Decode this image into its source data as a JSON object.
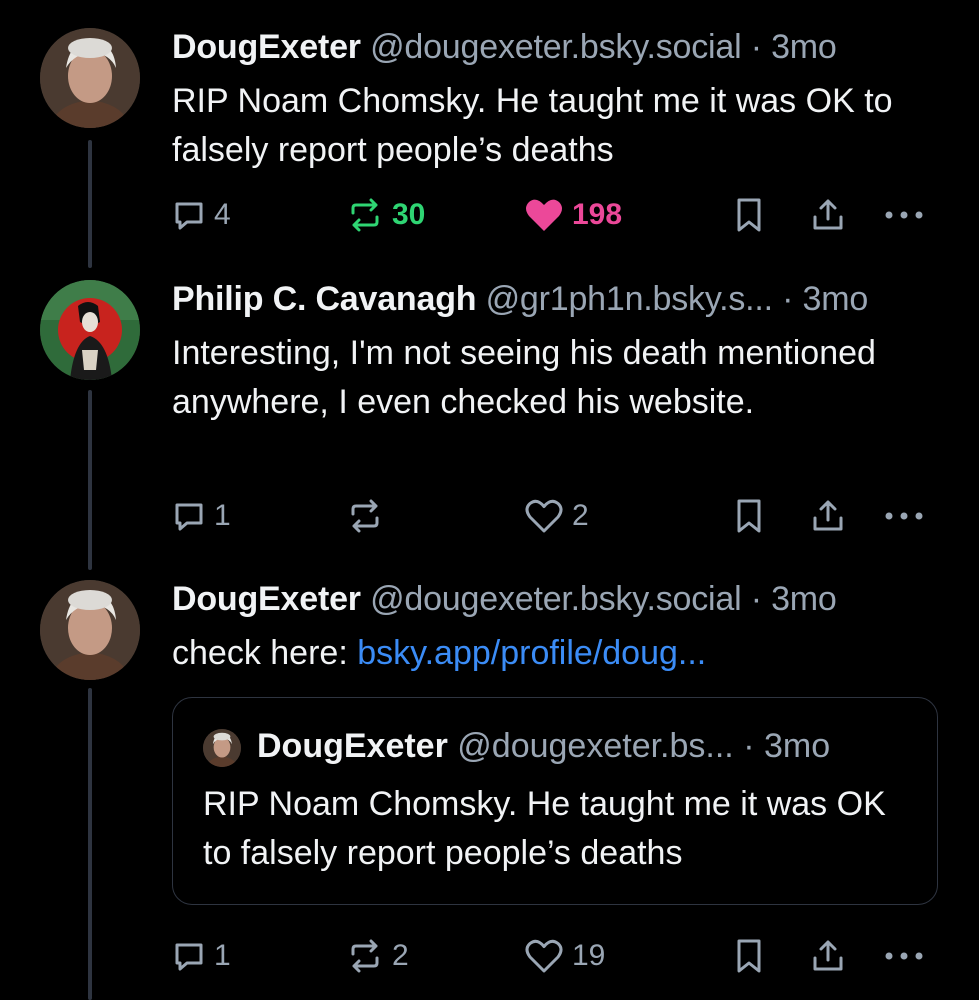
{
  "posts": [
    {
      "author_name": "DougExeter",
      "handle": "@dougexeter.bsky.social",
      "separator": "·",
      "time": "3mo",
      "text": "RIP Noam Chomsky. He taught me it was OK to falsely report people’s deaths",
      "replies": "4",
      "reposts": "30",
      "likes": "198",
      "reposted": true,
      "liked": true
    },
    {
      "author_name": "Philip C. Cavanagh",
      "handle": "@gr1ph1n.bsky.s...",
      "separator": "·",
      "time": "3mo",
      "text": "Interesting, I'm not seeing his death mentioned anywhere, I even checked his website.",
      "replies": "1",
      "reposts": "",
      "likes": "2",
      "reposted": false,
      "liked": false
    },
    {
      "author_name": "DougExeter",
      "handle": "@dougexeter.bsky.social",
      "separator": "·",
      "time": "3mo",
      "text_prefix": "check here: ",
      "link_text": "bsky.app/profile/doug...",
      "replies": "1",
      "reposts": "2",
      "likes": "19",
      "reposted": false,
      "liked": false,
      "quote": {
        "author_name": "DougExeter",
        "handle": "@dougexeter.bs...",
        "separator": "·",
        "time": "3mo",
        "text": "RIP Noam Chomsky. He taught me it was OK to falsely report people’s deaths"
      }
    }
  ],
  "colors": {
    "background": "#000000",
    "text": "#f1f3f5",
    "muted": "#9aa6b4",
    "link": "#3b8cf6",
    "repost_active": "#2fd573",
    "like_active": "#ec4899",
    "thread_line": "#2e3440"
  },
  "icons": [
    "reply-icon",
    "repost-icon",
    "like-icon",
    "bookmark-icon",
    "share-icon",
    "more-icon"
  ]
}
